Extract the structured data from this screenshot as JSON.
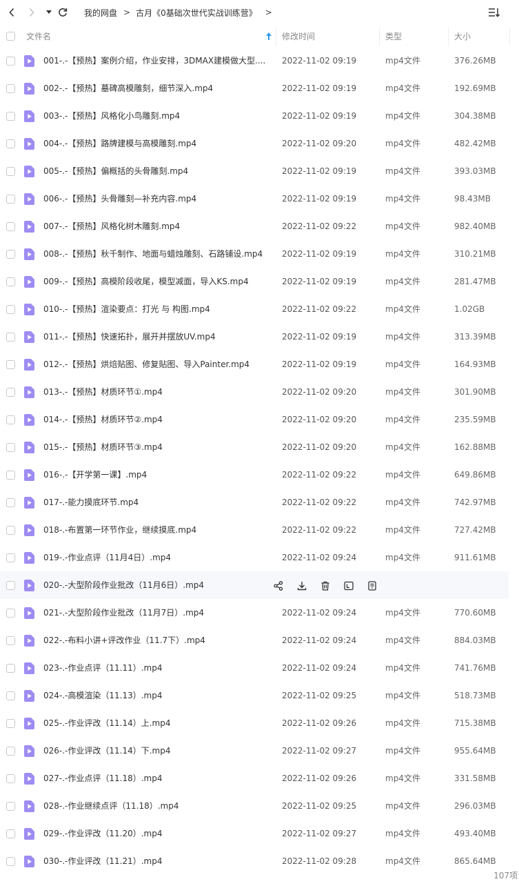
{
  "nav": {
    "breadcrumb": [
      "我的网盘",
      "古月《0基础次世代实战训练营》"
    ],
    "breadcrumb_sep": ">",
    "breadcrumb_more": ">"
  },
  "header": {
    "name": "文件名",
    "time": "修改时间",
    "type": "类型",
    "size": "大小"
  },
  "colors": {
    "accent": "#2c9cf0",
    "file_icon": "#9f8cf2",
    "row_hover": "#f6f8fb"
  },
  "files": [
    {
      "name": "001-.-【预热】案例介绍，作业安排，3DMAX建模做大型....",
      "time": "2022-11-02 09:19",
      "type": "mp4文件",
      "size": "376.26MB"
    },
    {
      "name": "002-.-【预热】墓碑高模雕刻，细节深入.mp4",
      "time": "2022-11-02 09:19",
      "type": "mp4文件",
      "size": "192.69MB"
    },
    {
      "name": "003-.-【预热】风格化小鸟雕刻.mp4",
      "time": "2022-11-02 09:19",
      "type": "mp4文件",
      "size": "304.38MB"
    },
    {
      "name": "004-.-【预热】路牌建模与高模雕刻.mp4",
      "time": "2022-11-02 09:20",
      "type": "mp4文件",
      "size": "482.42MB"
    },
    {
      "name": "005-.-【预热】偏概括的头骨雕刻.mp4",
      "time": "2022-11-02 09:19",
      "type": "mp4文件",
      "size": "393.03MB"
    },
    {
      "name": "006-.-【预热】头骨雕刻—补充内容.mp4",
      "time": "2022-11-02 09:19",
      "type": "mp4文件",
      "size": "98.43MB"
    },
    {
      "name": "007-.-【预热】风格化树木雕刻.mp4",
      "time": "2022-11-02 09:22",
      "type": "mp4文件",
      "size": "982.40MB"
    },
    {
      "name": "008-.-【预热】秋千制作、地面与蜡烛雕刻、石路铺设.mp4",
      "time": "2022-11-02 09:19",
      "type": "mp4文件",
      "size": "310.21MB"
    },
    {
      "name": "009-.-【预热】高模阶段收尾，模型减面，导入KS.mp4",
      "time": "2022-11-02 09:19",
      "type": "mp4文件",
      "size": "281.47MB"
    },
    {
      "name": "010-.-【预热】渲染要点：打光 与 构图.mp4",
      "time": "2022-11-02 09:22",
      "type": "mp4文件",
      "size": "1.02GB"
    },
    {
      "name": "011-.-【预热】快速拓扑，展开并摆放UV.mp4",
      "time": "2022-11-02 09:19",
      "type": "mp4文件",
      "size": "313.39MB"
    },
    {
      "name": "012-.-【预热】烘焙贴图、修复贴图、导入Painter.mp4",
      "time": "2022-11-02 09:19",
      "type": "mp4文件",
      "size": "164.93MB"
    },
    {
      "name": "013-.-【预热】材质环节①.mp4",
      "time": "2022-11-02 09:20",
      "type": "mp4文件",
      "size": "301.90MB"
    },
    {
      "name": "014-.-【预热】材质环节②.mp4",
      "time": "2022-11-02 09:20",
      "type": "mp4文件",
      "size": "235.59MB"
    },
    {
      "name": "015-.-【预热】材质环节③.mp4",
      "time": "2022-11-02 09:20",
      "type": "mp4文件",
      "size": "162.88MB"
    },
    {
      "name": "016-.-【开学第一课】.mp4",
      "time": "2022-11-02 09:22",
      "type": "mp4文件",
      "size": "649.86MB"
    },
    {
      "name": "017-.-能力摸底环节.mp4",
      "time": "2022-11-02 09:22",
      "type": "mp4文件",
      "size": "742.97MB"
    },
    {
      "name": "018-.-布置第一环节作业，继续摸底.mp4",
      "time": "2022-11-02 09:22",
      "type": "mp4文件",
      "size": "727.42MB"
    },
    {
      "name": "019-.-作业点评（11月4日）.mp4",
      "time": "2022-11-02 09:24",
      "type": "mp4文件",
      "size": "911.61MB"
    },
    {
      "name": "020-.-大型阶段作业批改（11月6日）.mp4",
      "time": "",
      "type": "",
      "size": "",
      "hover": true
    },
    {
      "name": "021-.-大型阶段作业批改（11月7日）.mp4",
      "time": "2022-11-02 09:24",
      "type": "mp4文件",
      "size": "770.60MB"
    },
    {
      "name": "022-.-布料小讲+评改作业（11.7下）.mp4",
      "time": "2022-11-02 09:24",
      "type": "mp4文件",
      "size": "884.03MB"
    },
    {
      "name": "023-.-作业点评（11.11）.mp4",
      "time": "2022-11-02 09:24",
      "type": "mp4文件",
      "size": "741.76MB"
    },
    {
      "name": "024-.-高模渲染（11.13）.mp4",
      "time": "2022-11-02 09:25",
      "type": "mp4文件",
      "size": "518.73MB"
    },
    {
      "name": "025-.-作业评改（11.14）上.mp4",
      "time": "2022-11-02 09:26",
      "type": "mp4文件",
      "size": "715.38MB"
    },
    {
      "name": "026-.-作业评改（11.14）下.mp4",
      "time": "2022-11-02 09:27",
      "type": "mp4文件",
      "size": "955.64MB"
    },
    {
      "name": "027-.-作业点评（11.18）.mp4",
      "time": "2022-11-02 09:26",
      "type": "mp4文件",
      "size": "331.58MB"
    },
    {
      "name": "028-.-作业继续点评（11.18）.mp4",
      "time": "2022-11-02 09:25",
      "type": "mp4文件",
      "size": "296.03MB"
    },
    {
      "name": "029-.-作业评改（11.20）.mp4",
      "time": "2022-11-02 09:27",
      "type": "mp4文件",
      "size": "493.40MB"
    },
    {
      "name": "030-.-作业评改（11.21）.mp4",
      "time": "2022-11-02 09:28",
      "type": "mp4文件",
      "size": "865.64MB"
    }
  ],
  "hover_actions": [
    "share-icon",
    "download-icon",
    "delete-icon",
    "rename-icon",
    "more-icon"
  ],
  "footer": {
    "count": "107项"
  }
}
